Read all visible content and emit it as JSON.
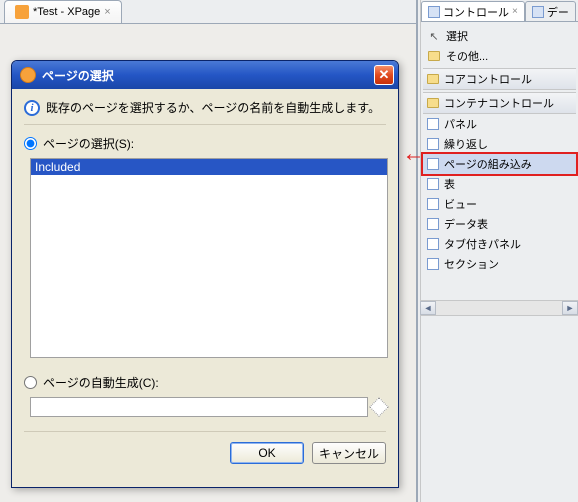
{
  "editor": {
    "tab_label": "*Test - XPage"
  },
  "dialog": {
    "title": "ページの選択",
    "info": "既存のページを選択するか、ページの名前を自動生成します。",
    "radio_select_label": "ページの選択(S):",
    "list_items": [
      "Included"
    ],
    "radio_gen_label": "ページの自動生成(C):",
    "gen_value": "",
    "ok_label": "OK",
    "cancel_label": "キャンセル"
  },
  "palette": {
    "tab1": "コントロール",
    "tab2": "デー",
    "select": "選択",
    "other": "その他...",
    "section_core": "コアコントロール",
    "section_container": "コンテナコントロール",
    "items": {
      "panel": "パネル",
      "repeat": "繰り返し",
      "include": "ページの組み込み",
      "table": "表",
      "view": "ビュー",
      "datatable": "データ表",
      "tabpanel": "タブ付きパネル",
      "section": "セクション"
    }
  },
  "footer_fragment": ""
}
